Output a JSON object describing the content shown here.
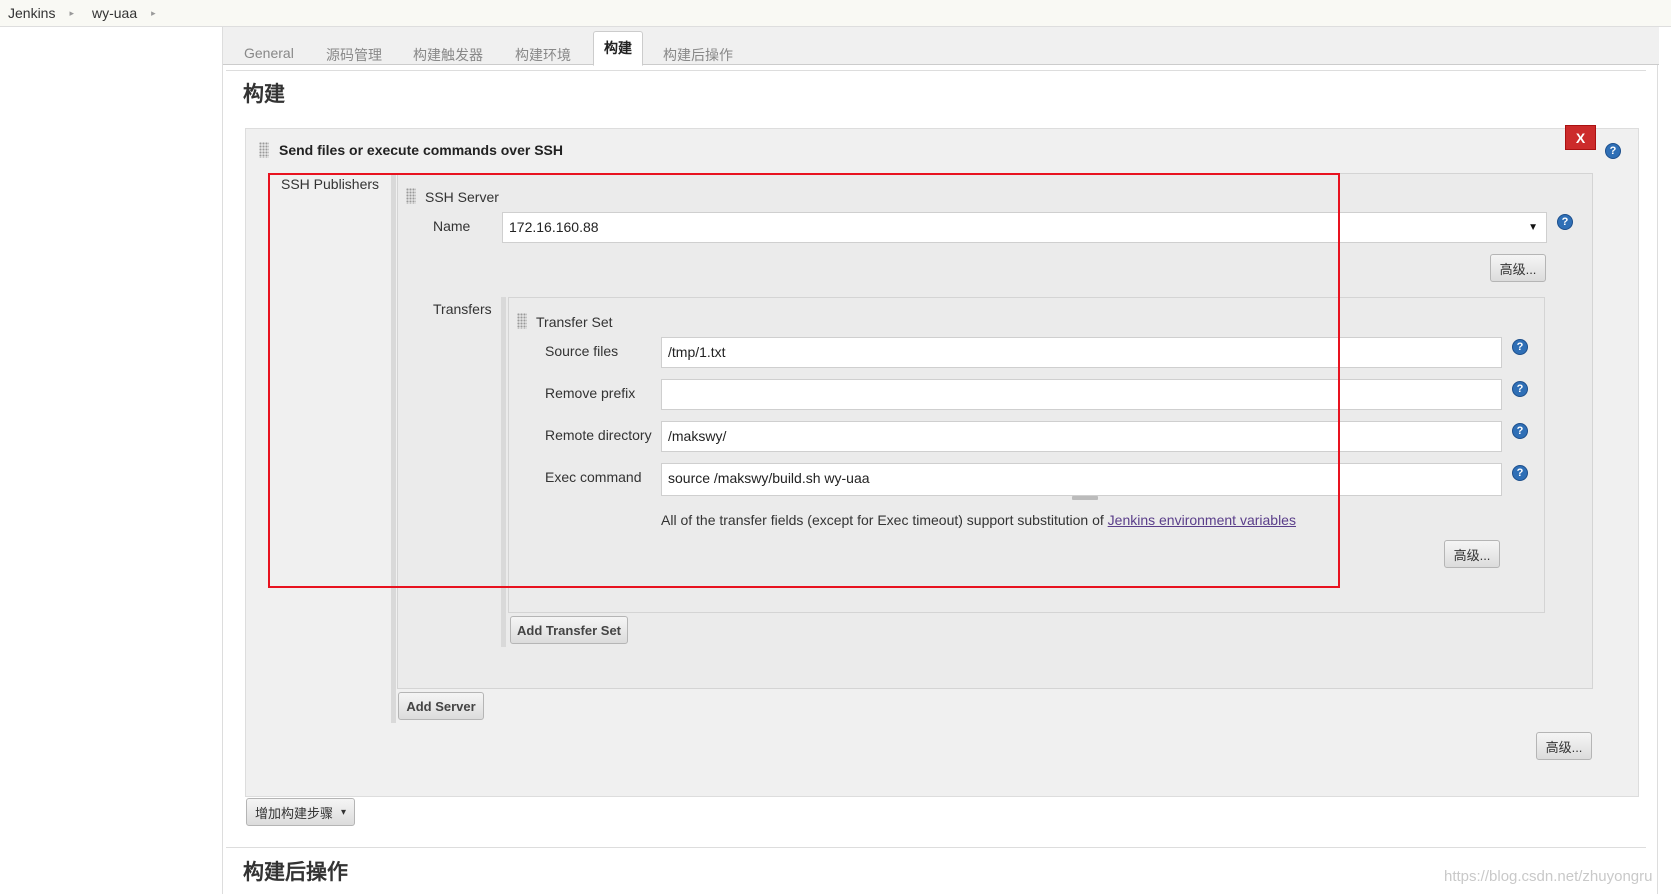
{
  "breadcrumb": {
    "items": [
      "Jenkins",
      "wy-uaa"
    ],
    "separator": "▸"
  },
  "tabs": [
    {
      "label": "General"
    },
    {
      "label": "源码管理"
    },
    {
      "label": "构建触发器"
    },
    {
      "label": "构建环境"
    },
    {
      "label": "构建",
      "active": true
    },
    {
      "label": "构建后操作"
    }
  ],
  "build_section": {
    "title": "构建",
    "step_title": "Send files or execute commands over SSH",
    "close_label": "X",
    "ssh_publishers_label": "SSH Publishers",
    "ssh_server": {
      "title": "SSH Server",
      "name_label": "Name",
      "name_value": "172.16.160.88",
      "advanced_label": "高级...",
      "transfers_label": "Transfers"
    },
    "transfer_set": {
      "title": "Transfer Set",
      "source_files_label": "Source files",
      "source_files_value": "/tmp/1.txt",
      "remove_prefix_label": "Remove prefix",
      "remove_prefix_value": "",
      "remote_directory_label": "Remote directory",
      "remote_directory_value": "/makswy/",
      "exec_command_label": "Exec command",
      "exec_command_value": "source /makswy/build.sh wy-uaa",
      "note_text": "All of the transfer fields (except for Exec timeout) support substitution of ",
      "note_link": "Jenkins environment variables",
      "advanced_label": "高级..."
    },
    "add_transfer_set_label": "Add Transfer Set",
    "add_server_label": "Add Server",
    "outer_advanced_label": "高级...",
    "add_build_step_label": "增加构建步骤",
    "add_build_step_arrow": "▾"
  },
  "post_build_section": {
    "title": "构建后操作"
  },
  "help_glyph": "?",
  "watermark": "https://blog.csdn.net/zhuyongru",
  "colors": {
    "highlight_box": "#e8121f",
    "help_icon": "#2f6fb6",
    "close_button": "#cc2b2b",
    "link": "#5a3e8a"
  }
}
